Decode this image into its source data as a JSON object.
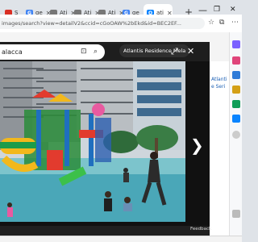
{
  "tabs": [
    {
      "label": "S",
      "favicon": "s-favicon",
      "color": "#d93025"
    },
    {
      "label": "ge",
      "favicon": "google-favicon",
      "color": "#4285f4"
    },
    {
      "label": "Ati",
      "favicon": "ati-favicon",
      "color": "#666666"
    },
    {
      "label": "Ati",
      "favicon": "ati-favicon",
      "color": "#666666"
    },
    {
      "label": "Ati",
      "favicon": "ati-favicon",
      "color": "#666666"
    },
    {
      "label": "ge",
      "favicon": "google-favicon",
      "color": "#4285f4"
    },
    {
      "label": "ati",
      "favicon": "bing-favicon",
      "color": "#0a84ff",
      "active": true
    }
  ],
  "window": {
    "new_tab": "+",
    "minimize": "—",
    "restore": "❐",
    "close": "✕"
  },
  "address": {
    "url": "images/search?view=detailV2&ccid=cGoOAW%2bEkd&id=BEC2EF...",
    "lock_icon": "lock-icon"
  },
  "lightbox": {
    "search_text": "alacca",
    "title": "Atlantis Residence Mela",
    "expand_icon": "expand-icon",
    "close_icon": "close-icon",
    "next_icon": "chevron-right-icon"
  },
  "side_results": {
    "line1": "Atlanti",
    "line2": "e Seri"
  },
  "status": {
    "feedback": "Feedback"
  },
  "colors": {
    "accent": "#0a84ff",
    "lightbox_bg": "#111111"
  }
}
